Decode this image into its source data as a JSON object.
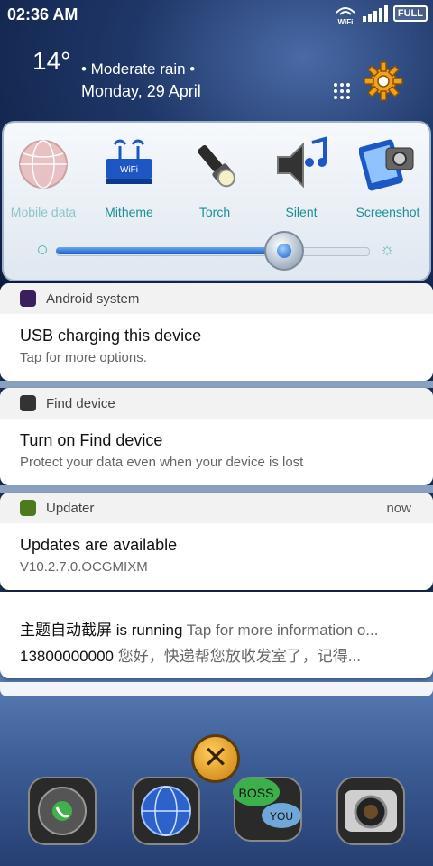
{
  "status_bar": {
    "time": "02:36 AM",
    "wifi_label": "WiFi",
    "battery_label": "FULL"
  },
  "weather": {
    "temperature": "14°",
    "condition": "• Moderate rain •",
    "date": "Monday, 29 April"
  },
  "quick_settings": {
    "tiles": [
      {
        "label": "Mobile data",
        "icon": "globe-icon",
        "active": false
      },
      {
        "label": "Mitheme",
        "icon": "wifi-router-icon",
        "active": true
      },
      {
        "label": "Torch",
        "icon": "flashlight-icon",
        "active": true
      },
      {
        "label": "Silent",
        "icon": "speaker-music-icon",
        "active": true
      },
      {
        "label": "Screenshot",
        "icon": "screenshot-camera-icon",
        "active": true
      }
    ],
    "brightness_level": 0.73
  },
  "notifications": [
    {
      "app": "Android system",
      "time": "",
      "title": "USB charging this device",
      "text": "Tap for more options."
    },
    {
      "app": "Find device",
      "time": "",
      "title": "Turn on Find device",
      "text": "Protect your data even when your device is lost"
    },
    {
      "app": "Updater",
      "time": "now",
      "title": "Updates are available",
      "text": "V10.2.7.0.OCGMIXM"
    }
  ],
  "collapsed_group": {
    "line1_bold": "主题自动截屏 is running",
    "line1_rest": "Tap for more information o...",
    "line2_bold": "13800000000",
    "line2_rest": "您好，快递帮您放收发室了，记得..."
  },
  "dock": [
    "phone-icon",
    "browser-globe-icon",
    "chat-boss-you-icon",
    "camera-icon"
  ],
  "colors": {
    "accent": "#1a8f93",
    "slider": "#1c5fc9",
    "close_button": "#e7a52a"
  }
}
